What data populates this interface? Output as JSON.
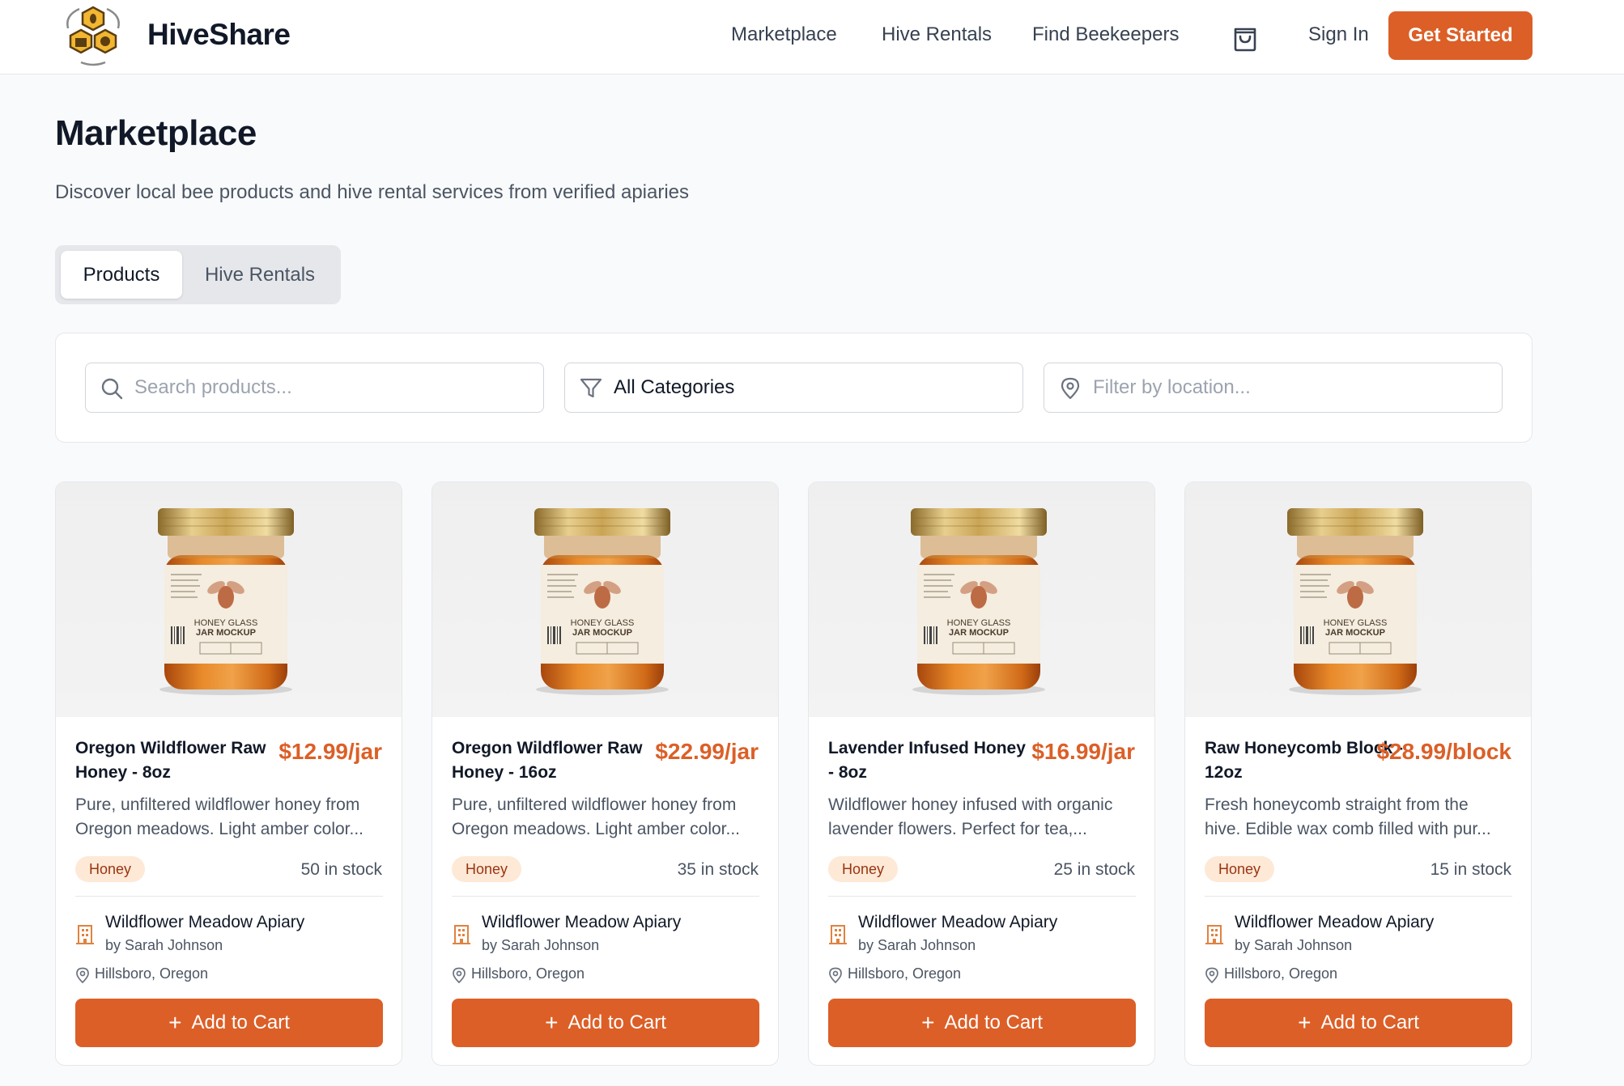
{
  "app": {
    "brand": "HiveShare",
    "accent_color": "#dc5f27"
  },
  "nav": {
    "links": [
      "Marketplace",
      "Hive Rentals",
      "Find Beekeepers"
    ],
    "cart_icon": "shopping-bag-icon",
    "sign_in": "Sign In",
    "get_started": "Get Started"
  },
  "page": {
    "title": "Marketplace",
    "subtitle": "Discover local bee products and hive rental services from verified apiaries"
  },
  "tabs": {
    "items": [
      "Products",
      "Hive Rentals"
    ],
    "selected": "Products"
  },
  "filters": {
    "search_placeholder": "Search products...",
    "category_value": "All Categories",
    "location_placeholder": "Filter by location..."
  },
  "products": [
    {
      "name": "Oregon Wildflower Raw Honey - 8oz",
      "price": "$12.99/jar",
      "desc_line1": "Pure, unfiltered wildflower honey from",
      "desc_line2": "Oregon meadows. Light amber color...",
      "category": "Honey",
      "stock": "50 in stock",
      "apiary": "Wildflower Meadow Apiary",
      "beekeeper": "by Sarah Johnson",
      "location": "Hillsboro, Oregon",
      "button": "Add to Cart"
    },
    {
      "name": "Oregon Wildflower Raw Honey - 16oz",
      "price": "$22.99/jar",
      "desc_line1": "Pure, unfiltered wildflower honey from",
      "desc_line2": "Oregon meadows. Light amber color...",
      "category": "Honey",
      "stock": "35 in stock",
      "apiary": "Wildflower Meadow Apiary",
      "beekeeper": "by Sarah Johnson",
      "location": "Hillsboro, Oregon",
      "button": "Add to Cart"
    },
    {
      "name": "Lavender Infused Honey - 8oz",
      "price": "$16.99/jar",
      "desc_line1": "Wildflower honey infused with organic",
      "desc_line2": "lavender flowers. Perfect for tea,...",
      "category": "Honey",
      "stock": "25 in stock",
      "apiary": "Wildflower Meadow Apiary",
      "beekeeper": "by Sarah Johnson",
      "location": "Hillsboro, Oregon",
      "button": "Add to Cart"
    },
    {
      "name": "Raw Honeycomb Block - 12oz",
      "price": "$28.99/block",
      "desc_line1": "Fresh honeycomb straight from the",
      "desc_line2": "hive. Edible wax comb filled with pur...",
      "category": "Honey",
      "stock": "15 in stock",
      "apiary": "Wildflower Meadow Apiary",
      "beekeeper": "by Sarah Johnson",
      "location": "Hillsboro, Oregon",
      "button": "Add to Cart"
    }
  ],
  "jar_label": {
    "line1": "HONEY GLASS",
    "line2": "JAR MOCKUP"
  }
}
